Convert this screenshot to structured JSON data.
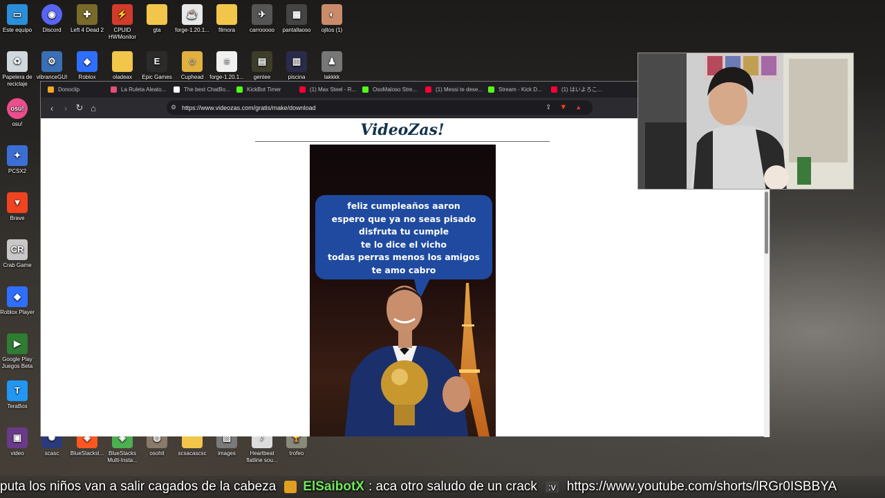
{
  "desktop": {
    "icons": [
      {
        "label": "Este equipo",
        "icon": "computer-icon",
        "color": "#2a8fd8",
        "glyph": "▭"
      },
      {
        "label": "Discord",
        "icon": "discord-icon",
        "color": "#5865f2",
        "glyph": "◉"
      },
      {
        "label": "Left 4 Dead 2",
        "icon": "game-icon",
        "color": "#7a6a2a",
        "glyph": "✚"
      },
      {
        "label": "CPUID HWMonitor",
        "icon": "hwmonitor-icon",
        "color": "#d23b2a",
        "glyph": "⚡"
      },
      {
        "label": "gta",
        "icon": "folder-icon",
        "color": "#f2c64a",
        "glyph": ""
      },
      {
        "label": "forge-1.20.1...",
        "icon": "java-icon",
        "color": "#e8e8e8",
        "glyph": "☕"
      },
      {
        "label": "filmora",
        "icon": "folder-icon",
        "color": "#f2c64a",
        "glyph": ""
      },
      {
        "label": "carrooooo",
        "icon": "image-icon",
        "color": "#555",
        "glyph": "✈"
      },
      {
        "label": "pantallaoso",
        "icon": "image-icon",
        "color": "#444",
        "glyph": "▦"
      },
      {
        "label": "ojitos (1)",
        "icon": "image-icon",
        "color": "#c98b6a",
        "glyph": "◐"
      },
      {
        "label": "Papelera de reciclaje",
        "icon": "recycle-bin-icon",
        "color": "#cfd8dc",
        "glyph": "♻"
      },
      {
        "label": "vibranceGUI",
        "icon": "vibrance-icon",
        "color": "#3a6fb5",
        "glyph": "⚙"
      },
      {
        "label": "Roblox",
        "icon": "roblox-icon",
        "color": "#2f6fff",
        "glyph": "◆"
      },
      {
        "label": "oladeax",
        "icon": "folder-icon",
        "color": "#f2c64a",
        "glyph": ""
      },
      {
        "label": "Epic Games",
        "icon": "epic-games-icon",
        "color": "#2b2b2b",
        "glyph": "E"
      },
      {
        "label": "Cuphead",
        "icon": "cuphead-icon",
        "color": "#e0b040",
        "glyph": "☺"
      },
      {
        "label": "forge-1.20.1...",
        "icon": "file-icon",
        "color": "#f0f0f0",
        "glyph": "≡"
      },
      {
        "label": "gentee",
        "icon": "image-icon",
        "color": "#3d3d2a",
        "glyph": "▤"
      },
      {
        "label": "piscina",
        "icon": "image-icon",
        "color": "#2a2a4a",
        "glyph": "▥"
      },
      {
        "label": "lakkkk",
        "icon": "image-icon",
        "color": "#777",
        "glyph": "♟"
      },
      {
        "label": "osu!",
        "icon": "osu-icon",
        "color": "#ea4f8b",
        "glyph": "osu!"
      },
      {
        "label": "PCSX2",
        "icon": "pcsx2-icon",
        "color": "#3b6fd6",
        "glyph": "✦"
      },
      {
        "label": "Brave",
        "icon": "brave-icon",
        "color": "#f0431f",
        "glyph": "▼"
      },
      {
        "label": "Crab Game",
        "icon": "crab-game-icon",
        "color": "#c8c8c8",
        "glyph": "CR"
      },
      {
        "label": "Roblox Player",
        "icon": "roblox-player-icon",
        "color": "#2f6fff",
        "glyph": "◆"
      },
      {
        "label": "Google Play Juegos Beta",
        "icon": "google-play-games-icon",
        "color": "#2e7d32",
        "glyph": "▶"
      },
      {
        "label": "TeraBox",
        "icon": "terabox-icon",
        "color": "#2196f3",
        "glyph": "T"
      },
      {
        "label": "video",
        "icon": "video-icon",
        "color": "#6a3a8a",
        "glyph": "▣"
      },
      {
        "label": "scasc",
        "icon": "image-icon",
        "color": "#2a3a7a",
        "glyph": "✺"
      },
      {
        "label": "BlueStacksl...",
        "icon": "bluestacks-icon",
        "color": "#ff5722",
        "glyph": "◈"
      },
      {
        "label": "BlueStacks Multi-Insta...",
        "icon": "bluestacks-multi-icon",
        "color": "#4caf50",
        "glyph": "◈"
      },
      {
        "label": "osohit",
        "icon": "image-icon",
        "color": "#8a7a6a",
        "glyph": "◍"
      },
      {
        "label": "scsacascsc",
        "icon": "folder-icon",
        "color": "#f2c64a",
        "glyph": ""
      },
      {
        "label": "images",
        "icon": "image-icon",
        "color": "#7a7a7a",
        "glyph": "▨"
      },
      {
        "label": "Heartbeat flatline sou...",
        "icon": "audio-icon",
        "color": "#dcdcdc",
        "glyph": "♪"
      },
      {
        "label": "trofeo",
        "icon": "image-icon",
        "color": "#8a8a7a",
        "glyph": "🏆"
      }
    ]
  },
  "browser": {
    "tabs": [
      {
        "label": "Donoclip",
        "color": "#f5a623"
      },
      {
        "label": "La Ruleta Aleato...",
        "color": "#e94e77"
      },
      {
        "label": "The best ChatBo...",
        "color": "#ffffff"
      },
      {
        "label": "KickBot Timer",
        "color": "#53fc18"
      },
      {
        "label": "(1) Max Steel - R...",
        "color": "#ff0033"
      },
      {
        "label": "OsoMaloso Stre...",
        "color": "#53fc18"
      },
      {
        "label": "(1) Messi te dese...",
        "color": "#ff0033"
      },
      {
        "label": "Stream - Kick D...",
        "color": "#53fc18"
      },
      {
        "label": "(1) はいよろこ...",
        "color": "#ff0033"
      }
    ],
    "url": "https://www.videozas.com/gratis/make/download",
    "page": {
      "logo": "VideoZas!",
      "bubble_lines": [
        "feliz cumpleaños aaron",
        "espero que ya no seas pisado",
        "disfruta tu cumple",
        "te lo dice el vicho",
        "todas perras menos los amigos",
        "te amo cabro"
      ]
    }
  },
  "ticker": {
    "text_before": "puta los niños van a salir cagados de la cabeza",
    "nick": "ElSaibotX",
    "message": ": aca otro saludo de un crack",
    "emote_text": ":v",
    "url_text": "https://www.youtube.com/shorts/lRGr0ISBBYA"
  },
  "colors": {
    "bubble": "#1f4aa0",
    "logo": "#12324a",
    "nick": "#6fe85a"
  }
}
